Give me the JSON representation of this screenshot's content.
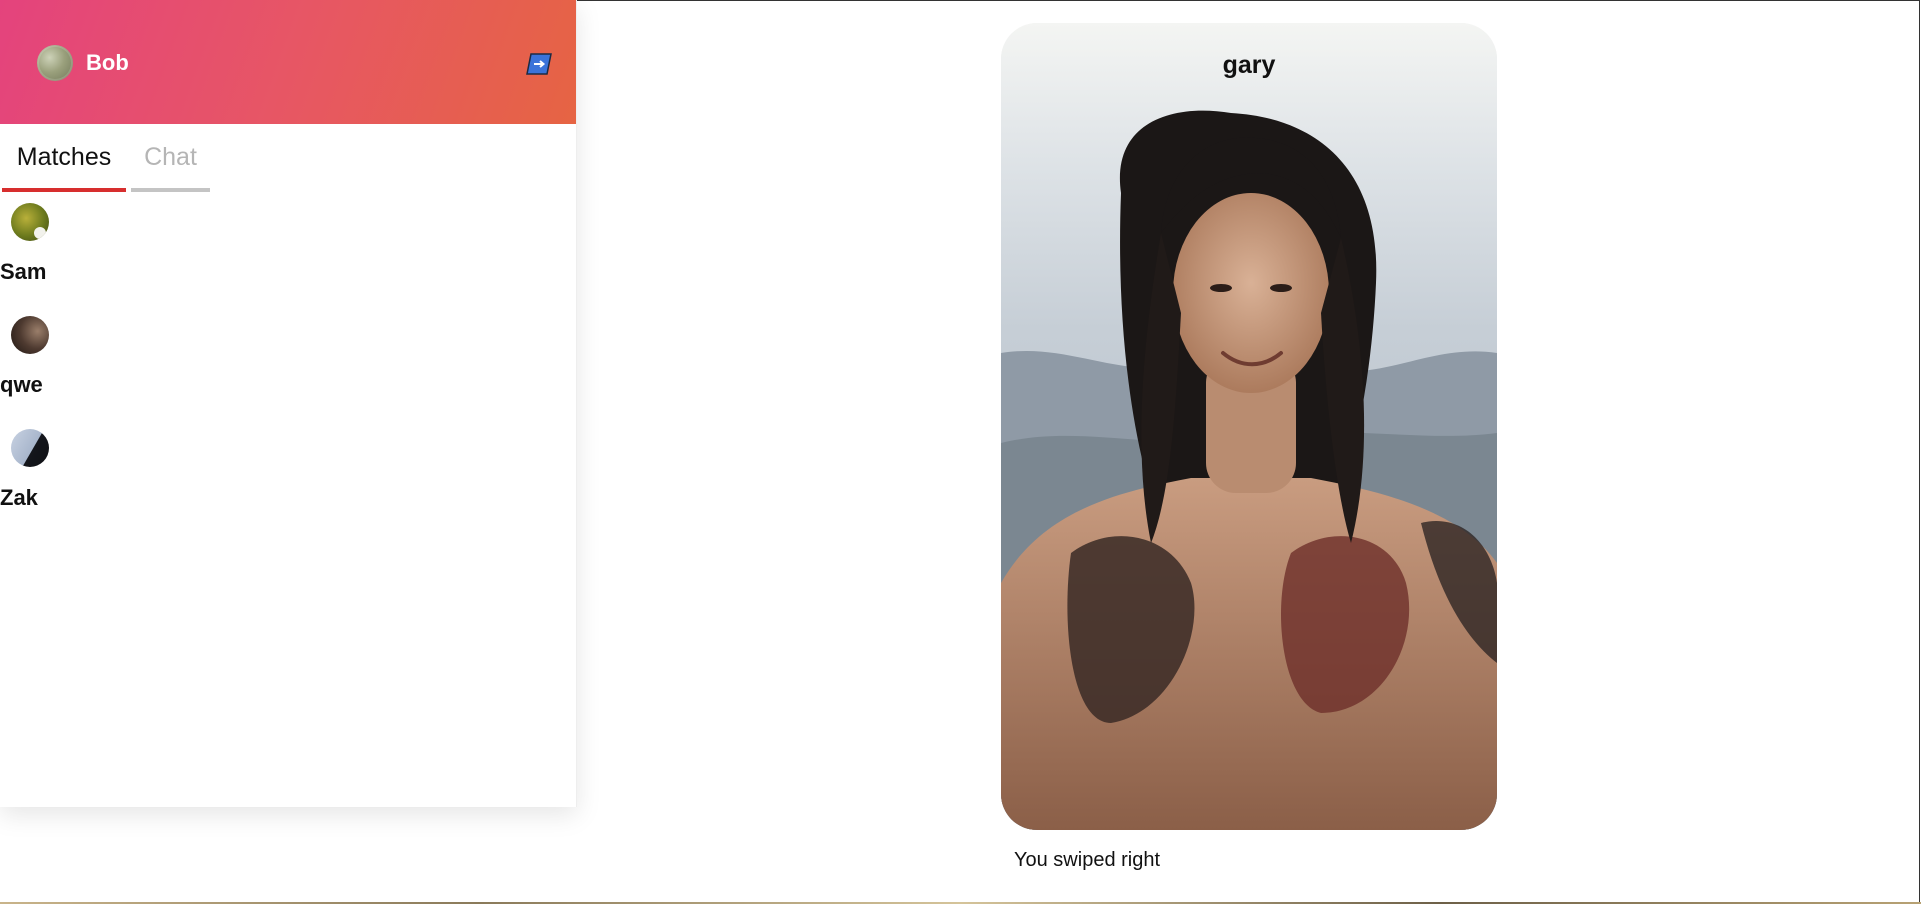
{
  "user": {
    "name": "Bob"
  },
  "header": {
    "logout_icon": "logout-arrow-icon"
  },
  "tabs": [
    {
      "label": "Matches",
      "active": true
    },
    {
      "label": "Chat",
      "active": false
    }
  ],
  "matches": [
    {
      "name": "Sam"
    },
    {
      "name": "qwe"
    },
    {
      "name": "Zak"
    }
  ],
  "card": {
    "name": "gary",
    "status": "You swiped right"
  },
  "colors": {
    "header_gradient_start": "#e4437d",
    "header_gradient_end": "#e66443",
    "active_tab_underline": "#d72e2e",
    "inactive_tab_underline": "#c4c4c4",
    "logout_icon_fill": "#3b73d9"
  }
}
